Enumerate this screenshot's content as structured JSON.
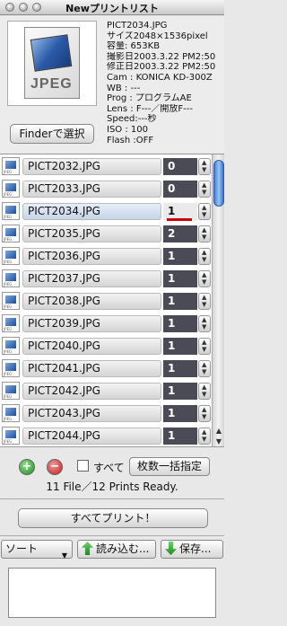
{
  "window": {
    "title": "Newプリントリスト"
  },
  "info": {
    "thumbnail_label": "JPEG",
    "finder_button": "Finderで選択",
    "meta": [
      "PICT2034.JPG",
      "サイズ2048×1536pixel",
      "容量:  653KB",
      "撮影日2003.3.22 PM2:50",
      "修正日2003.3.22 PM2:50",
      "Cam : KONICA KD-300Z",
      "WB :   ---",
      "Prog : プログラムAE",
      "Lens : F---／開放F---",
      "Speed:---秒",
      "ISO :   100",
      "Flash :OFF"
    ]
  },
  "files": [
    {
      "name": "PICT2032.JPG",
      "count": "0"
    },
    {
      "name": "PICT2033.JPG",
      "count": "0"
    },
    {
      "name": "PICT2034.JPG",
      "count": "1"
    },
    {
      "name": "PICT2035.JPG",
      "count": "2"
    },
    {
      "name": "PICT2036.JPG",
      "count": "1"
    },
    {
      "name": "PICT2037.JPG",
      "count": "1"
    },
    {
      "name": "PICT2038.JPG",
      "count": "1"
    },
    {
      "name": "PICT2039.JPG",
      "count": "1"
    },
    {
      "name": "PICT2040.JPG",
      "count": "1"
    },
    {
      "name": "PICT2041.JPG",
      "count": "1"
    },
    {
      "name": "PICT2042.JPG",
      "count": "1"
    },
    {
      "name": "PICT2043.JPG",
      "count": "1"
    },
    {
      "name": "PICT2044.JPG",
      "count": "1"
    }
  ],
  "selected_index": 2,
  "controls": {
    "add_symbol": "+",
    "remove_symbol": "−",
    "all_label": "すべて",
    "bulk_label": "枚数一括指定",
    "status": "11 File／12 Prints Ready.",
    "print_all": "すべてプリント！",
    "sort_label": "ソート",
    "load_label": "読み込む...",
    "save_label": "保存..."
  },
  "colors": {
    "count_bg": "#4b4b57",
    "selected_row": "#c6d4e8",
    "mark": "#cc0000"
  }
}
